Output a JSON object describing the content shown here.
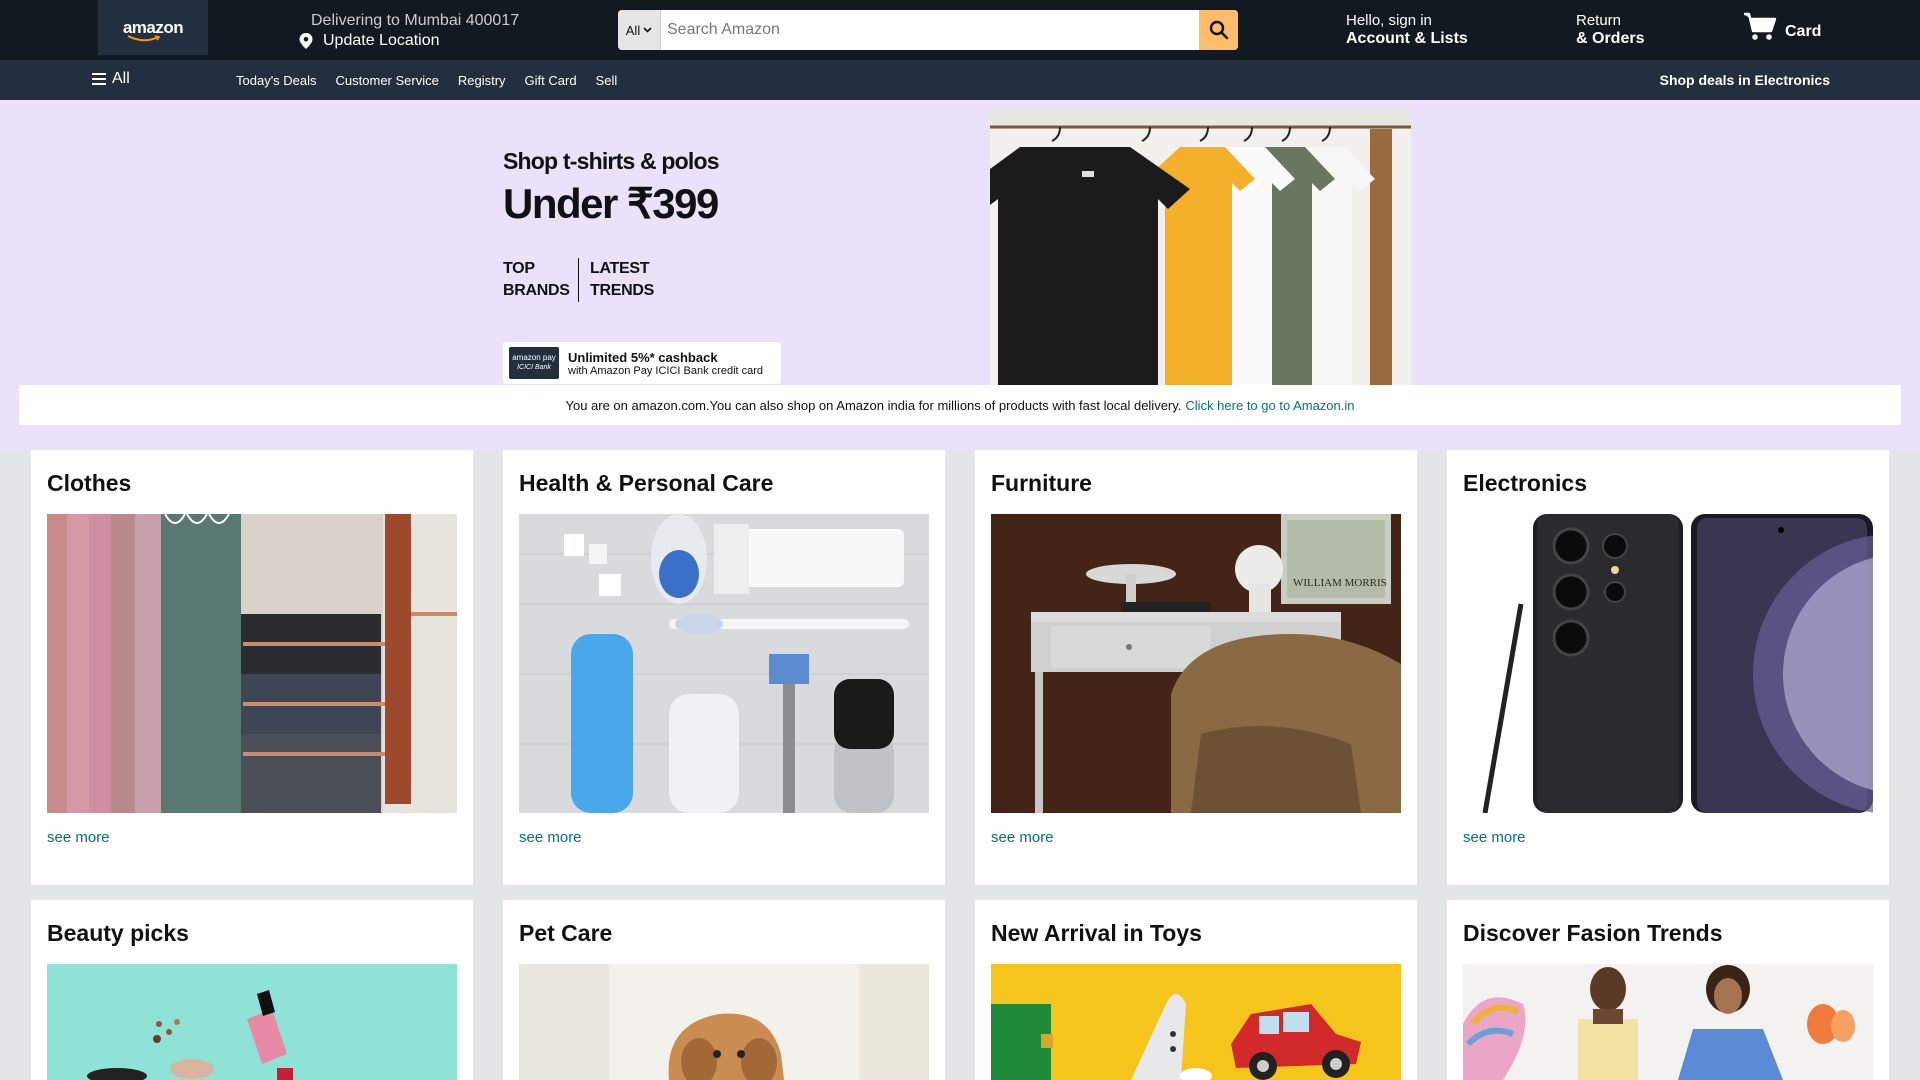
{
  "header": {
    "logo_text": "amazon",
    "deliver_line1": "Delivering to Mumbai 400017",
    "deliver_line2": "Update Location",
    "search": {
      "category": "All",
      "placeholder": "Search Amazon"
    },
    "account_line1": "Hello, sign in",
    "account_line2": "Account & Lists",
    "returns_line1": "Return",
    "returns_line2": "& Orders",
    "cart_label": "Card"
  },
  "subnav": {
    "all_label": "All",
    "links": [
      "Today's Deals",
      "Customer Service",
      "Registry",
      "Gift Card",
      "Sell"
    ],
    "right_label": "Shop deals in Electronics"
  },
  "hero": {
    "line1": "Shop t-shirts & polos",
    "line2": "Under ₹399",
    "tag1_line1": "TOP",
    "tag1_line2": "BRANDS",
    "tag2_line1": "LATEST",
    "tag2_line2": "TRENDS",
    "cashback_logo_line1": "amazon pay",
    "cashback_logo_line2": "ICICI Bank",
    "cashback_line1": "Unlimited 5%* cashback",
    "cashback_line2": "with Amazon Pay ICICI Bank credit card"
  },
  "notice": {
    "text": "You are on amazon.com.You can also shop on Amazon india for millions of products with fast local delivery.",
    "link": "Click here to go to Amazon.in"
  },
  "cards": [
    {
      "title": "Clothes",
      "link": "see more"
    },
    {
      "title": "Health & Personal Care",
      "link": "see more"
    },
    {
      "title": "Furniture",
      "link": "see more"
    },
    {
      "title": "Electronics",
      "link": "see more"
    },
    {
      "title": "Beauty picks",
      "link": ""
    },
    {
      "title": "Pet Care",
      "link": ""
    },
    {
      "title": "New Arrival in Toys",
      "link": ""
    },
    {
      "title": "Discover Fasion Trends",
      "link": ""
    }
  ],
  "colors": {
    "nav_dark": "#131921",
    "nav_sub": "#232f3e",
    "search_button": "#febd69",
    "hero_bg": "#ece1fb",
    "link": "#007185"
  }
}
